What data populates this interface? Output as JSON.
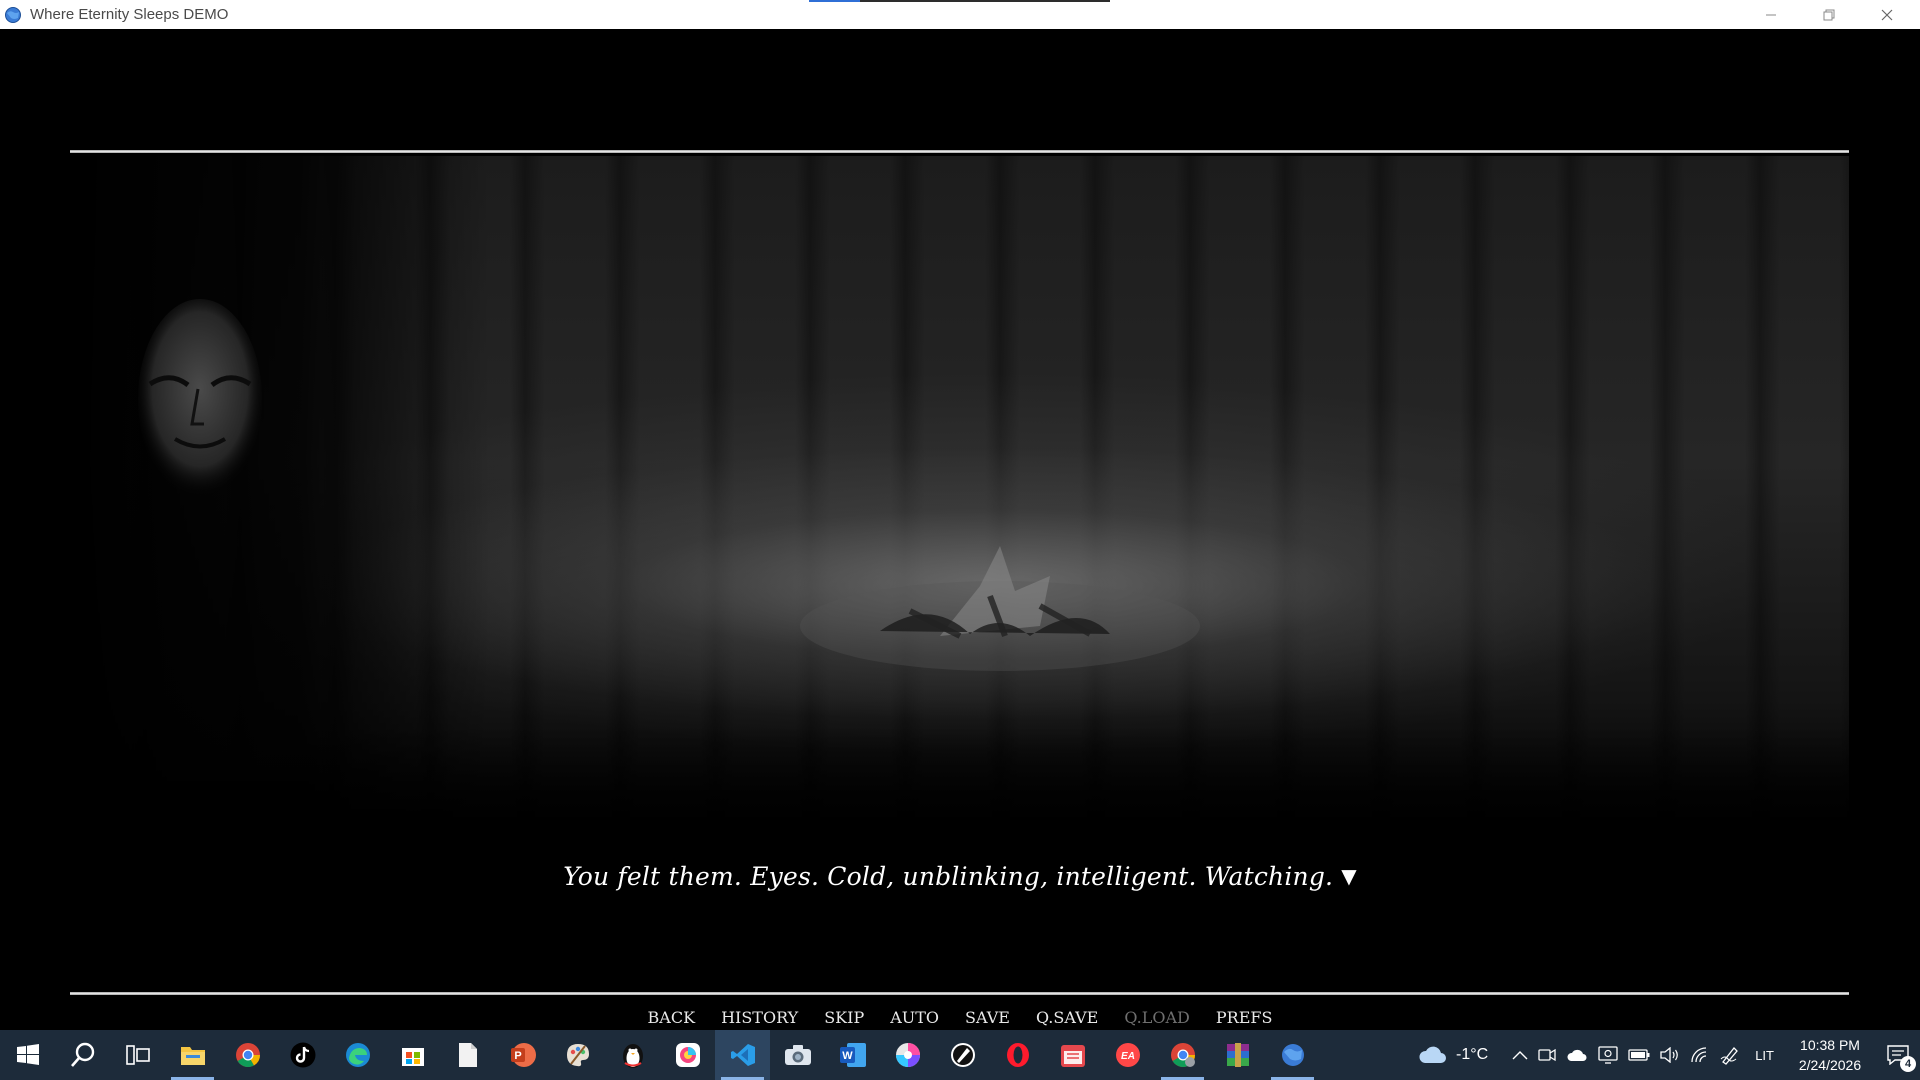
{
  "window": {
    "title": "Where Eternity Sleeps DEMO",
    "loading_progress": 0.17
  },
  "game": {
    "dialogue": "You felt them. Eyes. Cold, unblinking, intelligent. Watching.",
    "ctc_glyph": "▼",
    "quick_menu": [
      {
        "label": "BACK",
        "enabled": true
      },
      {
        "label": "HISTORY",
        "enabled": true
      },
      {
        "label": "SKIP",
        "enabled": true
      },
      {
        "label": "AUTO",
        "enabled": true
      },
      {
        "label": "SAVE",
        "enabled": true
      },
      {
        "label": "Q.SAVE",
        "enabled": true
      },
      {
        "label": "Q.LOAD",
        "enabled": false
      },
      {
        "label": "PREFS",
        "enabled": true
      }
    ]
  },
  "taskbar": {
    "apps": [
      {
        "name": "start",
        "icon": "windows-logo-icon"
      },
      {
        "name": "search",
        "icon": "search-icon"
      },
      {
        "name": "task-view",
        "icon": "task-view-icon"
      },
      {
        "name": "file-explorer",
        "icon": "folder-icon",
        "running": true
      },
      {
        "name": "chrome",
        "icon": "chrome-icon"
      },
      {
        "name": "tiktok",
        "icon": "tiktok-icon"
      },
      {
        "name": "edge",
        "icon": "edge-icon"
      },
      {
        "name": "store",
        "icon": "store-icon"
      },
      {
        "name": "notepad",
        "icon": "document-icon"
      },
      {
        "name": "powerpoint",
        "icon": "powerpoint-icon"
      },
      {
        "name": "paint",
        "icon": "paint-palette-icon"
      },
      {
        "name": "penguin-app",
        "icon": "penguin-icon"
      },
      {
        "name": "picsart",
        "icon": "picsart-icon"
      },
      {
        "name": "vscode",
        "icon": "vscode-icon",
        "active": true
      },
      {
        "name": "camera",
        "icon": "camera-icon"
      },
      {
        "name": "word",
        "icon": "word-icon"
      },
      {
        "name": "color-app",
        "icon": "color-wheel-icon"
      },
      {
        "name": "inkscape",
        "icon": "pen-tool-icon"
      },
      {
        "name": "opera",
        "icon": "opera-icon"
      },
      {
        "name": "calendar-app",
        "icon": "calendar-icon"
      },
      {
        "name": "ea-app",
        "icon": "ea-icon"
      },
      {
        "name": "chrome-2",
        "icon": "chrome-icon",
        "running": true
      },
      {
        "name": "winrar",
        "icon": "winrar-icon"
      },
      {
        "name": "renpy-game",
        "icon": "game-globe-icon",
        "running": true
      }
    ],
    "weather": "-1°C",
    "language": "LIT",
    "time": "10:38 PM",
    "date": "2/24/2026",
    "notifications": "4"
  },
  "colors": {
    "taskbar": "#1d2b3a",
    "active_app": "#2d4560",
    "running_underline": "#8ab4e8",
    "disabled_menu": "#6f6f6f"
  }
}
